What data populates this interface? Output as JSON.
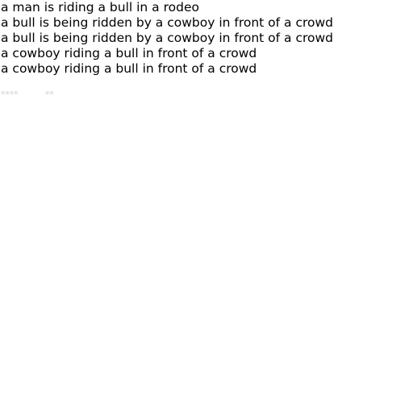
{
  "captions": [
    "a man is riding a bull in a rodeo",
    "a bull is being ridden by a cowboy in front of a crowd",
    "a bull is being ridden by a cowboy in front of a crowd",
    "a cowboy riding a bull in front of a crowd",
    "a cowboy riding a bull in front of a crowd"
  ]
}
